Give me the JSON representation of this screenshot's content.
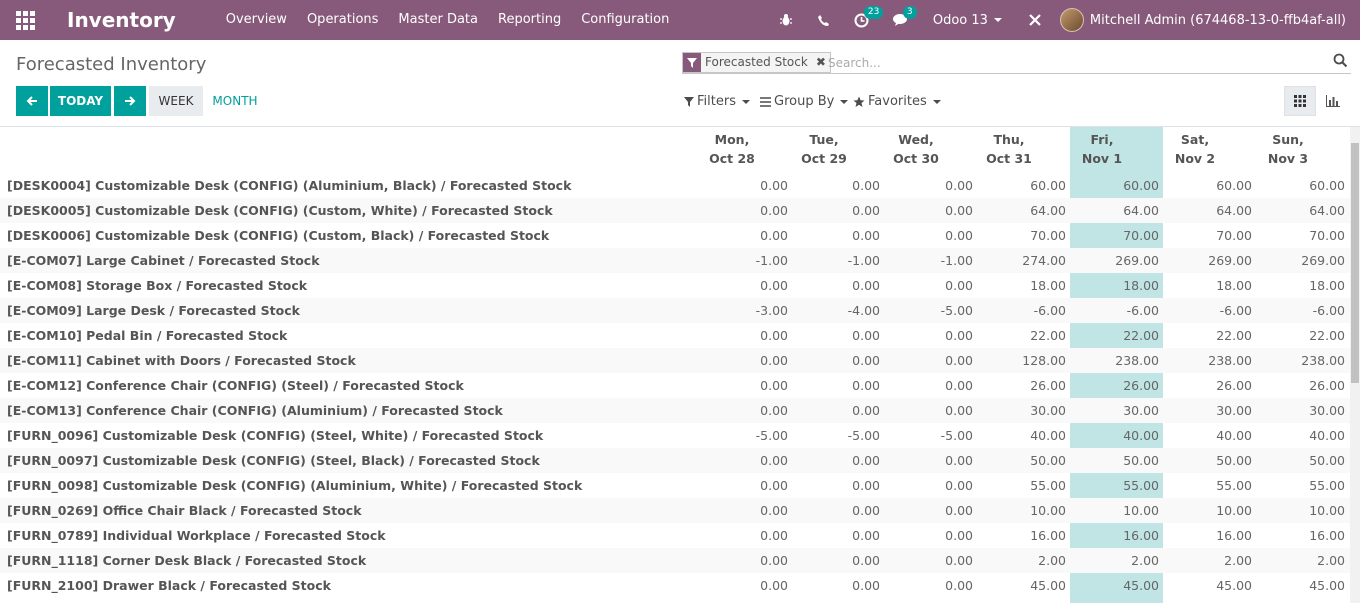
{
  "navbar": {
    "app_title": "Inventory",
    "menu": [
      "Overview",
      "Operations",
      "Master Data",
      "Reporting",
      "Configuration"
    ],
    "activity_count": "23",
    "message_count": "3",
    "database": "Odoo 13",
    "user_name": "Mitchell Admin (674468-13-0-ffb4af-all)"
  },
  "control_panel": {
    "breadcrumb": "Forecasted Inventory",
    "facet_label": "Forecasted Stock",
    "search_placeholder": "Search...",
    "today_label": "TODAY",
    "week_label": "WEEK",
    "month_label": "MONTH",
    "filters_label": "Filters",
    "groupby_label": "Group By",
    "favorites_label": "Favorites"
  },
  "grid": {
    "columns": [
      {
        "day": "Mon,",
        "date": "Oct 28"
      },
      {
        "day": "Tue,",
        "date": "Oct 29"
      },
      {
        "day": "Wed,",
        "date": "Oct 30"
      },
      {
        "day": "Thu,",
        "date": "Oct 31"
      },
      {
        "day": "Fri,",
        "date": "Nov 1"
      },
      {
        "day": "Sat,",
        "date": "Nov 2"
      },
      {
        "day": "Sun,",
        "date": "Nov 3"
      }
    ],
    "today_column_index": 4,
    "rows": [
      {
        "label": "[DESK0004] Customizable Desk (CONFIG) (Aluminium, Black)  /  Forecasted Stock",
        "values": [
          "0.00",
          "0.00",
          "0.00",
          "60.00",
          "60.00",
          "60.00",
          "60.00"
        ]
      },
      {
        "label": "[DESK0005] Customizable Desk (CONFIG) (Custom, White)  /  Forecasted Stock",
        "values": [
          "0.00",
          "0.00",
          "0.00",
          "64.00",
          "64.00",
          "64.00",
          "64.00"
        ]
      },
      {
        "label": "[DESK0006] Customizable Desk (CONFIG) (Custom, Black)  /  Forecasted Stock",
        "values": [
          "0.00",
          "0.00",
          "0.00",
          "70.00",
          "70.00",
          "70.00",
          "70.00"
        ]
      },
      {
        "label": "[E-COM07] Large Cabinet  /  Forecasted Stock",
        "values": [
          "-1.00",
          "-1.00",
          "-1.00",
          "274.00",
          "269.00",
          "269.00",
          "269.00"
        ]
      },
      {
        "label": "[E-COM08] Storage Box  /  Forecasted Stock",
        "values": [
          "0.00",
          "0.00",
          "0.00",
          "18.00",
          "18.00",
          "18.00",
          "18.00"
        ]
      },
      {
        "label": "[E-COM09] Large Desk  /  Forecasted Stock",
        "values": [
          "-3.00",
          "-4.00",
          "-5.00",
          "-6.00",
          "-6.00",
          "-6.00",
          "-6.00"
        ]
      },
      {
        "label": "[E-COM10] Pedal Bin  /  Forecasted Stock",
        "values": [
          "0.00",
          "0.00",
          "0.00",
          "22.00",
          "22.00",
          "22.00",
          "22.00"
        ]
      },
      {
        "label": "[E-COM11] Cabinet with Doors  /  Forecasted Stock",
        "values": [
          "0.00",
          "0.00",
          "0.00",
          "128.00",
          "238.00",
          "238.00",
          "238.00"
        ]
      },
      {
        "label": "[E-COM12] Conference Chair (CONFIG) (Steel)  /  Forecasted Stock",
        "values": [
          "0.00",
          "0.00",
          "0.00",
          "26.00",
          "26.00",
          "26.00",
          "26.00"
        ]
      },
      {
        "label": "[E-COM13] Conference Chair (CONFIG) (Aluminium)  /  Forecasted Stock",
        "values": [
          "0.00",
          "0.00",
          "0.00",
          "30.00",
          "30.00",
          "30.00",
          "30.00"
        ]
      },
      {
        "label": "[FURN_0096] Customizable Desk (CONFIG) (Steel, White)  /  Forecasted Stock",
        "values": [
          "-5.00",
          "-5.00",
          "-5.00",
          "40.00",
          "40.00",
          "40.00",
          "40.00"
        ]
      },
      {
        "label": "[FURN_0097] Customizable Desk (CONFIG) (Steel, Black)  /  Forecasted Stock",
        "values": [
          "0.00",
          "0.00",
          "0.00",
          "50.00",
          "50.00",
          "50.00",
          "50.00"
        ]
      },
      {
        "label": "[FURN_0098] Customizable Desk (CONFIG) (Aluminium, White)  /  Forecasted Stock",
        "values": [
          "0.00",
          "0.00",
          "0.00",
          "55.00",
          "55.00",
          "55.00",
          "55.00"
        ]
      },
      {
        "label": "[FURN_0269] Office Chair Black  /  Forecasted Stock",
        "values": [
          "0.00",
          "0.00",
          "0.00",
          "10.00",
          "10.00",
          "10.00",
          "10.00"
        ]
      },
      {
        "label": "[FURN_0789] Individual Workplace  /  Forecasted Stock",
        "values": [
          "0.00",
          "0.00",
          "0.00",
          "16.00",
          "16.00",
          "16.00",
          "16.00"
        ]
      },
      {
        "label": "[FURN_1118] Corner Desk Black  /  Forecasted Stock",
        "values": [
          "0.00",
          "0.00",
          "0.00",
          "2.00",
          "2.00",
          "2.00",
          "2.00"
        ]
      },
      {
        "label": "[FURN_2100] Drawer Black  /  Forecasted Stock",
        "values": [
          "0.00",
          "0.00",
          "0.00",
          "45.00",
          "45.00",
          "45.00",
          "45.00"
        ]
      }
    ]
  },
  "colors": {
    "navbar": "#875a7b",
    "accent": "#00a09d",
    "today_highlight": "#c0e5e4"
  }
}
